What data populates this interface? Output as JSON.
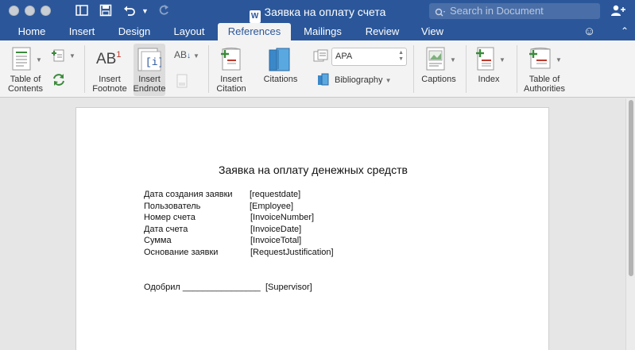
{
  "window": {
    "title": "Заявка на оплату счета",
    "doc_icon_letter": "W",
    "search_placeholder": "Search in Document"
  },
  "tabs": [
    {
      "label": "Home"
    },
    {
      "label": "Insert"
    },
    {
      "label": "Design"
    },
    {
      "label": "Layout"
    },
    {
      "label": "References",
      "active": true
    },
    {
      "label": "Mailings"
    },
    {
      "label": "Review"
    },
    {
      "label": "View"
    }
  ],
  "ribbon": {
    "toc_label_1": "Table of",
    "toc_label_2": "Contents",
    "footnote_label_1": "Insert",
    "footnote_label_2": "Footnote",
    "footnote_icon_text": "AB",
    "footnote_icon_sup": "1",
    "endnote_label_1": "Insert",
    "endnote_label_2": "Endnote",
    "next_footnote_icon_text": "AB",
    "citation_label_1": "Insert",
    "citation_label_2": "Citation",
    "citations_label": "Citations",
    "style_value": "APA",
    "bibliography_label": "Bibliography",
    "captions_label": "Captions",
    "index_label": "Index",
    "authorities_label_1": "Table of",
    "authorities_label_2": "Authorities"
  },
  "document": {
    "heading": "Заявка на оплату денежных средств",
    "fields": [
      {
        "label": "Дата создания заявки",
        "value": "[requestdate]"
      },
      {
        "label": "Пользователь",
        "value": "[Employee]"
      },
      {
        "label": "Номер счета",
        "value": "[InvoiceNumber]"
      },
      {
        "label": "Дата счета",
        "value": "[InvoiceDate]"
      },
      {
        "label": "Сумма",
        "value": "[InvoiceTotal]"
      },
      {
        "label": "Основание заявки",
        "value": "[RequestJustification]"
      }
    ],
    "approval_label": "Одобрил",
    "approval_line": "________________",
    "approval_value": "[Supervisor]"
  },
  "colors": {
    "brand": "#2b579a",
    "ribbon_bg": "#f3f3f3",
    "canvas_bg": "#e6e6e6"
  }
}
